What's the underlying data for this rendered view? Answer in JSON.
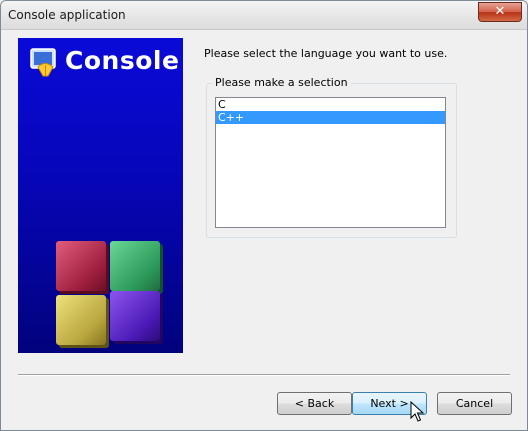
{
  "window": {
    "title": "Console application",
    "close_label": "✕"
  },
  "banner": {
    "title": "Console"
  },
  "main": {
    "prompt": "Please select the language you want to use.",
    "group_label": "Please make a selection",
    "items": [
      {
        "label": "C",
        "selected": false
      },
      {
        "label": "C++",
        "selected": true
      }
    ]
  },
  "buttons": {
    "back": "< Back",
    "next": "Next >",
    "cancel": "Cancel"
  },
  "colors": {
    "banner_top": "#0a0ad8",
    "banner_bottom": "#02027d",
    "selection": "#3399ff"
  }
}
